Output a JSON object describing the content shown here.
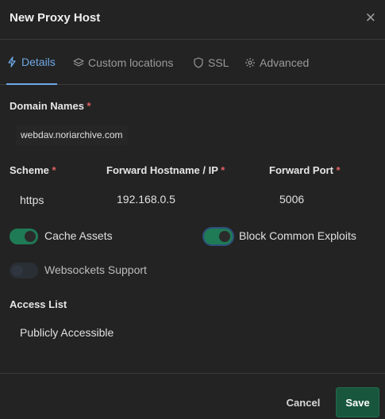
{
  "modal": {
    "title": "New Proxy Host",
    "close_icon": "close-icon"
  },
  "tabs": [
    {
      "label": "Details",
      "icon": "bolt-icon",
      "active": true
    },
    {
      "label": "Custom locations",
      "icon": "layers-icon",
      "active": false
    },
    {
      "label": "SSL",
      "icon": "shield-icon",
      "active": false
    },
    {
      "label": "Advanced",
      "icon": "gear-icon",
      "active": false
    }
  ],
  "form": {
    "domain_names": {
      "label": "Domain Names",
      "required_mark": "*",
      "value": "webdav.noriarchive.com"
    },
    "scheme": {
      "label": "Scheme",
      "required_mark": "*",
      "value": "https"
    },
    "forward_host": {
      "label": "Forward Hostname / IP",
      "required_mark": "*",
      "value": "192.168.0.5"
    },
    "forward_port": {
      "label": "Forward Port",
      "required_mark": "*",
      "value": "5006"
    },
    "cache_assets": {
      "label": "Cache Assets",
      "enabled": true
    },
    "block_exploits": {
      "label": "Block Common Exploits",
      "enabled": true
    },
    "websockets": {
      "label": "Websockets Support",
      "enabled": false
    },
    "access_list": {
      "label": "Access List",
      "value": "Publicly Accessible"
    }
  },
  "footer": {
    "cancel_label": "Cancel",
    "save_label": "Save"
  },
  "colors": {
    "background": "#232323",
    "accent": "#6ea8e6",
    "toggle_on": "#1f7a56",
    "save_button": "#18563d",
    "required": "#e06060"
  }
}
